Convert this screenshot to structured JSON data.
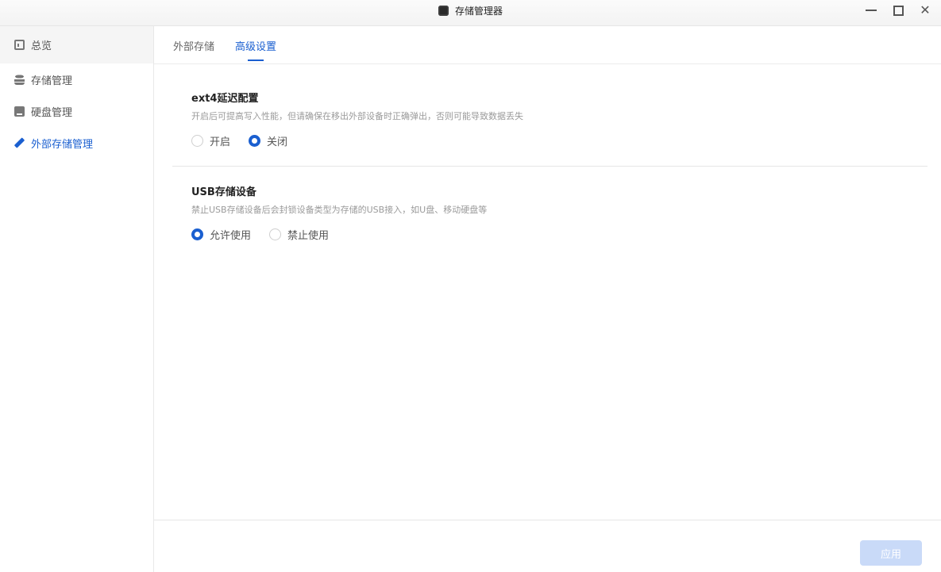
{
  "window": {
    "title": "存储管理器",
    "app_icon": "storage-manager-icon",
    "controls": [
      "minimize-icon",
      "maximize-icon",
      "close-icon"
    ]
  },
  "sidebar": {
    "items": [
      {
        "label": "总览",
        "icon": "overview-icon",
        "active": false
      },
      {
        "label": "存储管理",
        "icon": "storage-stack-icon",
        "active": false
      },
      {
        "label": "硬盘管理",
        "icon": "disk-icon",
        "active": false
      },
      {
        "label": "外部存储管理",
        "icon": "pen-icon",
        "active": true
      }
    ]
  },
  "tabs": [
    {
      "label": "外部存储",
      "active": false
    },
    {
      "label": "高级设置",
      "active": true
    }
  ],
  "sections": [
    {
      "title": "ext4延迟配置",
      "description": "开启后可提高写入性能，但请确保在移出外部设备时正确弹出，否则可能导致数据丢失",
      "options": [
        {
          "label": "开启",
          "checked": false
        },
        {
          "label": "关闭",
          "checked": true
        }
      ]
    },
    {
      "title": "USB存储设备",
      "description": "禁止USB存储设备后会封锁设备类型为存储的USB接入，如U盘、移动硬盘等",
      "options": [
        {
          "label": "允许使用",
          "checked": true
        },
        {
          "label": "禁止使用",
          "checked": false
        }
      ]
    }
  ],
  "footer": {
    "apply_label": "应用",
    "apply_enabled": false
  },
  "colors": {
    "accent": "#1a5fd0",
    "apply_disabled_bg": "#c9daf8"
  }
}
